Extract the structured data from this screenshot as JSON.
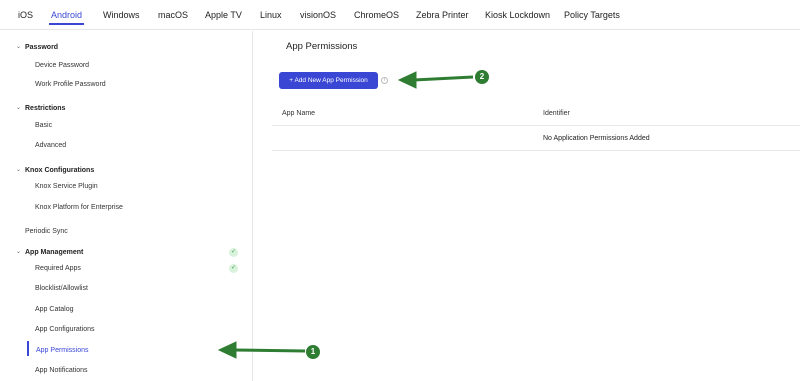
{
  "tabs": [
    {
      "label": "iOS"
    },
    {
      "label": "Android"
    },
    {
      "label": "Windows"
    },
    {
      "label": "macOS"
    },
    {
      "label": "Apple TV"
    },
    {
      "label": "Linux"
    },
    {
      "label": "visionOS"
    },
    {
      "label": "ChromeOS"
    },
    {
      "label": "Zebra Printer"
    },
    {
      "label": "Kiosk Lockdown"
    },
    {
      "label": "Policy Targets"
    }
  ],
  "active_tab": "Android",
  "sidebar": {
    "sections": [
      {
        "label": "Password",
        "items": [
          "Device Password",
          "Work Profile Password"
        ]
      },
      {
        "label": "Restrictions",
        "items": [
          "Basic",
          "Advanced"
        ]
      },
      {
        "label": "Knox Configurations",
        "items": [
          "Knox Service Plugin",
          "Knox Platform for Enterprise"
        ]
      },
      {
        "label": "Periodic Sync"
      },
      {
        "label": "App Management",
        "items": [
          "Required Apps",
          "Blocklist/Allowlist",
          "App Catalog",
          "App Configurations",
          "App Permissions",
          "App Notifications"
        ]
      }
    ],
    "active_item": "App Permissions"
  },
  "main": {
    "title": "App Permissions",
    "add_button_label": "+ Add New App Permission",
    "columns": [
      "App Name",
      "Identifier"
    ],
    "empty_message": "No Application Permissions Added"
  },
  "annotations": [
    "1",
    "2"
  ],
  "colors": {
    "accent": "#3a47d5",
    "annotation": "#2e7d32",
    "check_bg": "#d9f2dc"
  }
}
